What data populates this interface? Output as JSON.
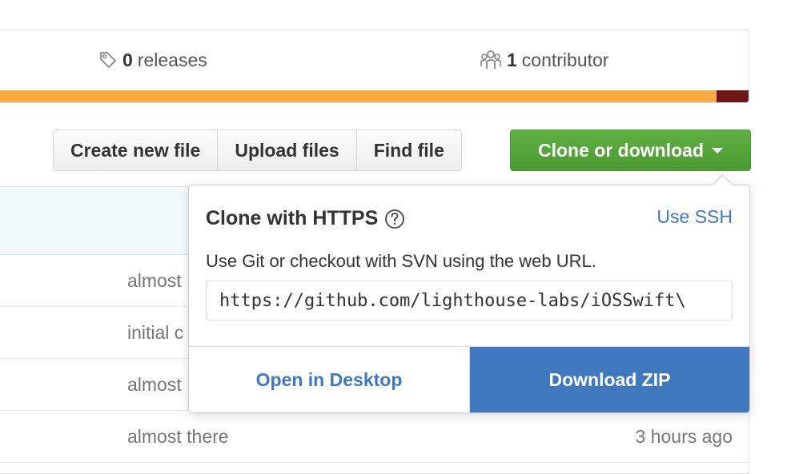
{
  "summary": {
    "releases_count": "0",
    "releases_label": "releases",
    "contributors_count": "1",
    "contributors_label": "contributor",
    "releases_icon": "tag-icon",
    "contributors_icon": "organization-icon"
  },
  "language_bar": [
    {
      "color": "#ffac45"
    },
    {
      "color": "#6f1717"
    }
  ],
  "toolbar": {
    "create_new_file": "Create new file",
    "upload_files": "Upload files",
    "find_file": "Find file",
    "clone_or_download": "Clone or download"
  },
  "files": [
    {
      "message": "almost",
      "age": ""
    },
    {
      "message": "initial c",
      "age": ""
    },
    {
      "message": "almost",
      "age": ""
    },
    {
      "message": "almost there",
      "age": "3 hours ago"
    }
  ],
  "clone_dropdown": {
    "title": "Clone with HTTPS",
    "use_ssh": "Use SSH",
    "description": "Use Git or checkout with SVN using the web URL.",
    "url": "https://github.com/lighthouse-labs/iOSSwift\\",
    "open_in_desktop": "Open in Desktop",
    "download_zip": "Download ZIP"
  },
  "colors": {
    "accent_blue": "#4078c0",
    "clone_green": "#5ca941"
  }
}
